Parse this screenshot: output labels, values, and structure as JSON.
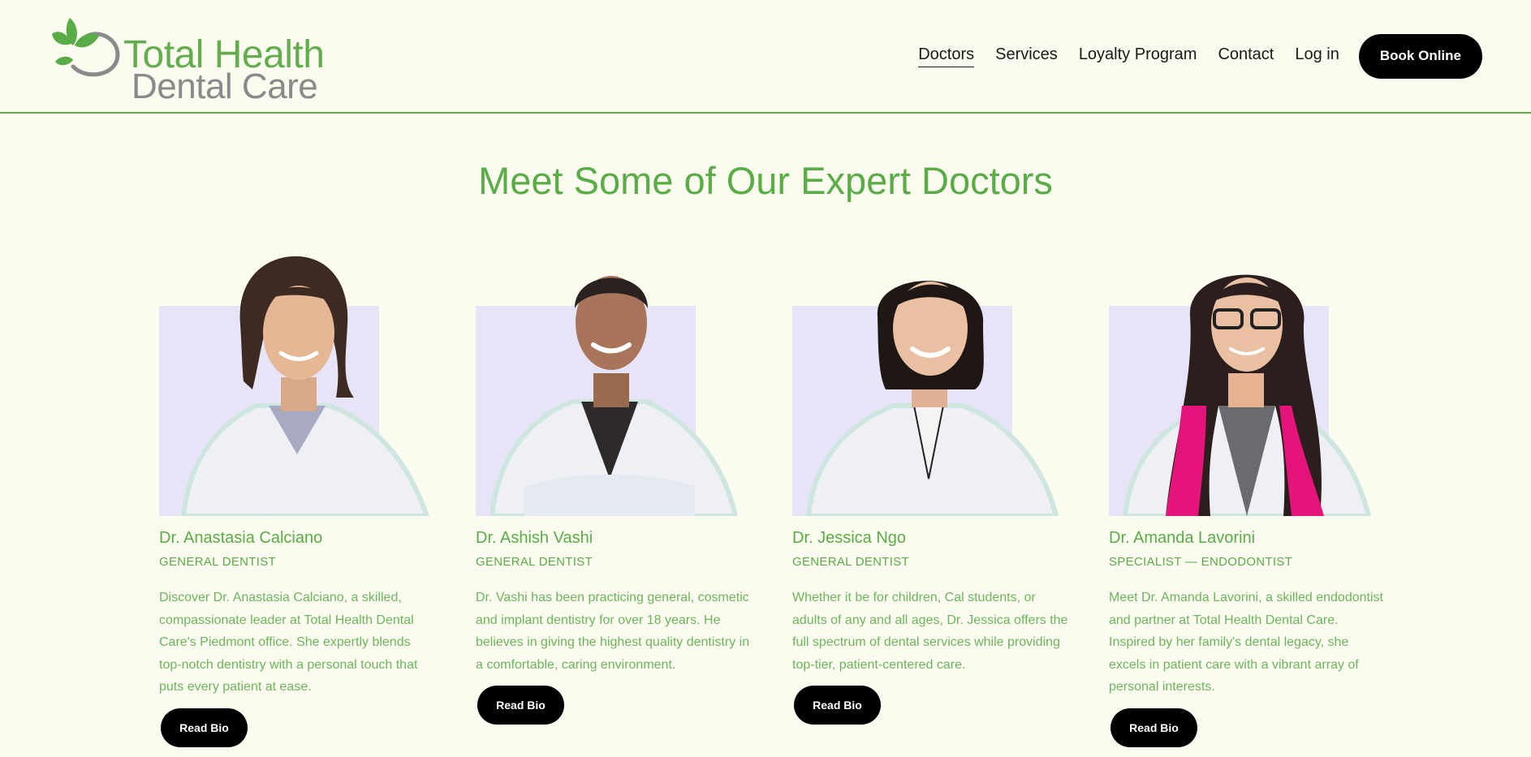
{
  "brand": {
    "name_line1": "Total Health",
    "name_line2": "Dental Care",
    "green": "#5aac47",
    "logo_icon": "leaf-arc-logo-icon"
  },
  "nav": {
    "items": [
      {
        "label": "Doctors",
        "active": true
      },
      {
        "label": "Services",
        "active": false
      },
      {
        "label": "Loyalty Program",
        "active": false
      },
      {
        "label": "Contact",
        "active": false
      },
      {
        "label": "Log in",
        "active": false
      }
    ],
    "cta_label": "Book Online"
  },
  "main": {
    "title": "Meet Some of Our Expert Doctors",
    "doctors": [
      {
        "name": "Dr. Anastasia Calciano",
        "role": "GENERAL DENTIST",
        "description": "Discover Dr. Anastasia Calciano, a skilled, compassionate leader at Total Health Dental Care's Piedmont office. She expertly blends top-notch dentistry with a personal touch that puts every patient at ease.",
        "button_label": "Read Bio"
      },
      {
        "name": "Dr. Ashish Vashi",
        "role": "GENERAL DENTIST",
        "description": "Dr. Vashi has been practicing general, cosmetic and implant dentistry for over 18 years. He believes in giving the highest quality dentistry in a comfortable, caring environment.",
        "button_label": "Read Bio"
      },
      {
        "name": "Dr. Jessica Ngo",
        "role": "GENERAL DENTIST",
        "description": "Whether it be for children, Cal students, or adults of any and all ages, Dr. Jessica offers the full spectrum of dental services while providing top-tier, patient-centered care.",
        "button_label": "Read Bio"
      },
      {
        "name": "Dr. Amanda Lavorini",
        "role": "SPECIALIST — ENDODONTIST",
        "description": "Meet Dr. Amanda Lavorini, a skilled endodontist and partner at Total Health Dental Care. Inspired by her family's dental legacy, she excels in patient care with a vibrant array of personal interests.",
        "button_label": "Read Bio"
      }
    ]
  }
}
